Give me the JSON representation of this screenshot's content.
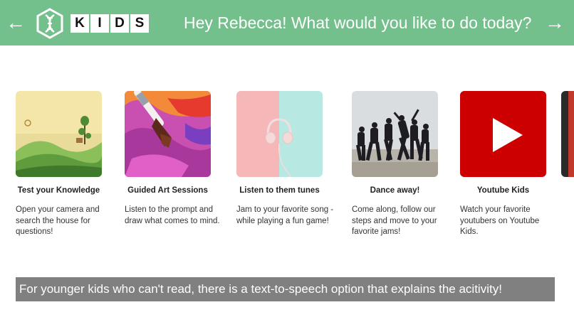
{
  "header": {
    "brand_letters": [
      "K",
      "I",
      "D",
      "S"
    ],
    "greeting": "Hey Rebecca! What would you like to do today?",
    "back_icon": "arrow-left-icon",
    "forward_icon": "arrow-right-icon",
    "logo_icon": "dna-hexagon-icon",
    "background_color": "#74c08c"
  },
  "activities": [
    {
      "title": "Test your Knowledge",
      "description": "Open your camera and search the house for questions!",
      "image": "hills-landscape-illustration"
    },
    {
      "title": "Guided Art Sessions",
      "description": "Listen to the prompt and draw what comes to mind.",
      "image": "paintbrush-on-paint"
    },
    {
      "title": "Listen to them tunes",
      "description": "Jam to your favorite song - while playing a fun game!",
      "image": "headphones-on-pastel"
    },
    {
      "title": "Dance away!",
      "description": "Come along, follow our steps and move to your favorite jams!",
      "image": "dance-group-photo"
    },
    {
      "title": "Youtube Kids",
      "description": "Watch your favorite youtubers on Youtube Kids.",
      "image": "youtube-play-icon"
    }
  ],
  "banner": {
    "text": "For younger kids who can't read, there is a text-to-speech option that explains the acitivity!",
    "background_color": "#808080"
  }
}
